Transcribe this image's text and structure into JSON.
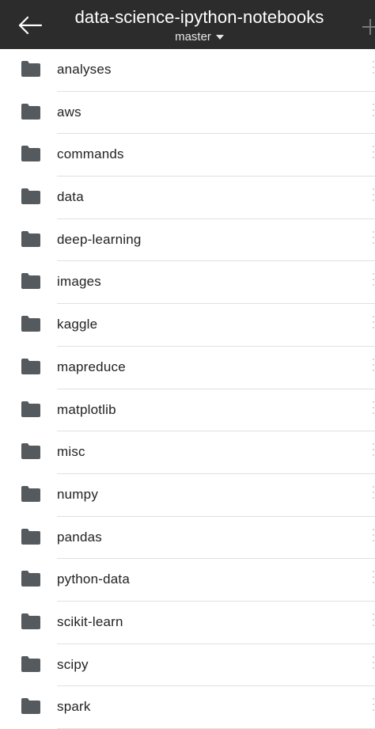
{
  "header": {
    "title": "data-science-ipython-notebooks",
    "branch": "master"
  },
  "icons": {
    "back": "arrow-left-icon",
    "add": "plus-icon",
    "folder": "folder-icon",
    "more": "more-vertical-icon"
  },
  "colors": {
    "header_bg": "#2c2c2c",
    "folder": "#555a5e"
  },
  "folders": [
    {
      "name": "analyses"
    },
    {
      "name": "aws"
    },
    {
      "name": "commands"
    },
    {
      "name": "data"
    },
    {
      "name": "deep-learning"
    },
    {
      "name": "images"
    },
    {
      "name": "kaggle"
    },
    {
      "name": "mapreduce"
    },
    {
      "name": "matplotlib"
    },
    {
      "name": "misc"
    },
    {
      "name": "numpy"
    },
    {
      "name": "pandas"
    },
    {
      "name": "python-data"
    },
    {
      "name": "scikit-learn"
    },
    {
      "name": "scipy"
    },
    {
      "name": "spark"
    }
  ]
}
